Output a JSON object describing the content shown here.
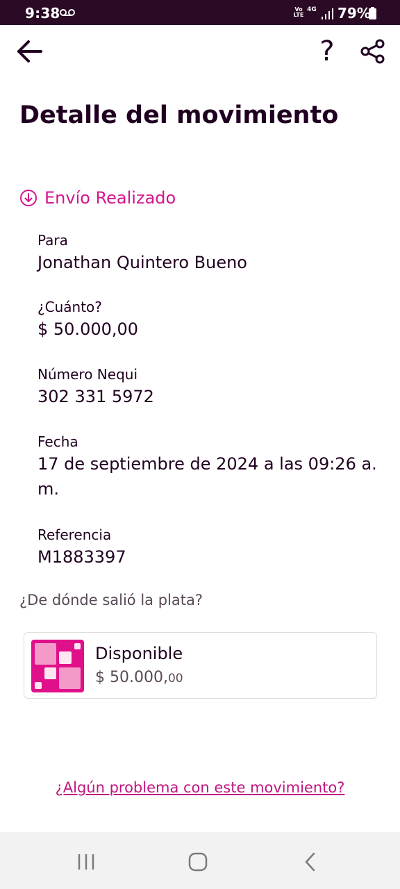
{
  "status_bar": {
    "time": "9:38",
    "volte": "Vo\nLTE",
    "network": "4G",
    "battery": "79%"
  },
  "header": {
    "title": "Detalle del movimiento"
  },
  "movement": {
    "status": "Envío Realizado",
    "fields": [
      {
        "label": "Para",
        "value": "Jonathan Quintero Bueno"
      },
      {
        "label": "¿Cuánto?",
        "value": "$ 50.000,00"
      },
      {
        "label": "Número Nequi",
        "value": "302 331 5972"
      },
      {
        "label": "Fecha",
        "value": "17 de septiembre de 2024 a las 09:26 a. m."
      },
      {
        "label": "Referencia",
        "value": "M1883397"
      }
    ]
  },
  "source": {
    "question": "¿De dónde salió la plata?",
    "account_name": "Disponible",
    "account_amount_main": "$ 50.000,",
    "account_amount_cents": "00"
  },
  "footer": {
    "problem_link": "¿Algún problema con este movimiento?"
  },
  "colors": {
    "accent": "#d4148c",
    "status_bar": "#2a0a24",
    "text": "#200020"
  }
}
